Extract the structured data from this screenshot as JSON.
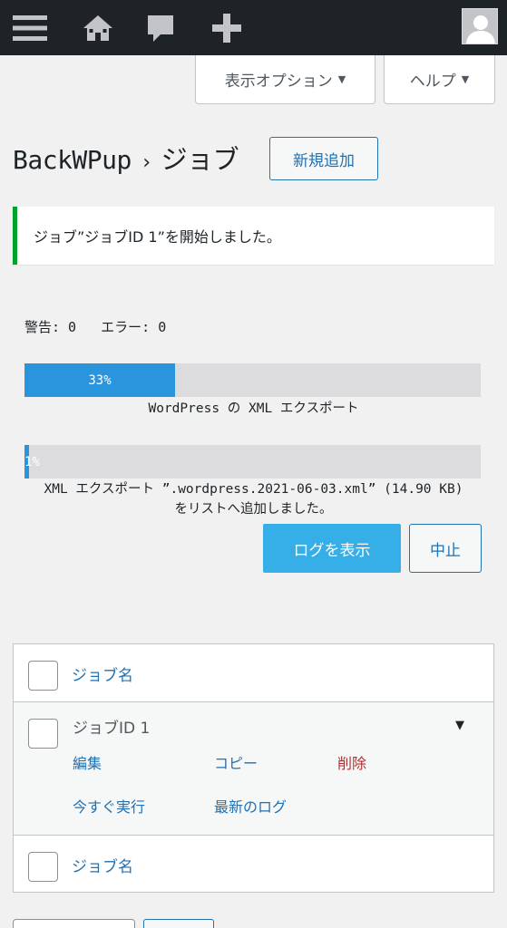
{
  "adminbar": {
    "icons": [
      "menu-icon",
      "home-icon",
      "comment-icon",
      "plus-icon"
    ]
  },
  "screen_meta": {
    "options_label": "表示オプション",
    "help_label": "ヘルプ"
  },
  "header": {
    "brand": "BackWPup",
    "separator": "›",
    "section": "ジョブ",
    "add_new_label": "新規追加"
  },
  "notice": {
    "text": "ジョブ”ジョブID 1”を開始しました。"
  },
  "progress": {
    "warnings_text": "警告: 0   エラー: 0",
    "step": {
      "percent_label": "33%",
      "percent": 33,
      "label": "WordPress の XML エクスポート"
    },
    "substep": {
      "percent_label": "1%",
      "percent": 1,
      "label_line1": "XML エクスポート ”.wordpress.2021-06-03.xml” (14.90 KB)",
      "label_line2": "をリストへ追加しました。"
    },
    "show_log_label": "ログを表示",
    "abort_label": "中止"
  },
  "table": {
    "header_label": "ジョブ名",
    "footer_label": "ジョブ名",
    "rows": [
      {
        "name": "ジョブID 1",
        "actions": {
          "edit": "編集",
          "copy": "コピー",
          "delete": "削除",
          "run_now": "今すぐ実行",
          "last_log": "最新のログ"
        }
      }
    ]
  },
  "colors": {
    "adminbar": "#1d2327",
    "link": "#2271b1",
    "progress_fill": "#2a95dd",
    "primary_button": "#36aee8",
    "success_border": "#00a32a",
    "delete": "#b32d2e"
  }
}
